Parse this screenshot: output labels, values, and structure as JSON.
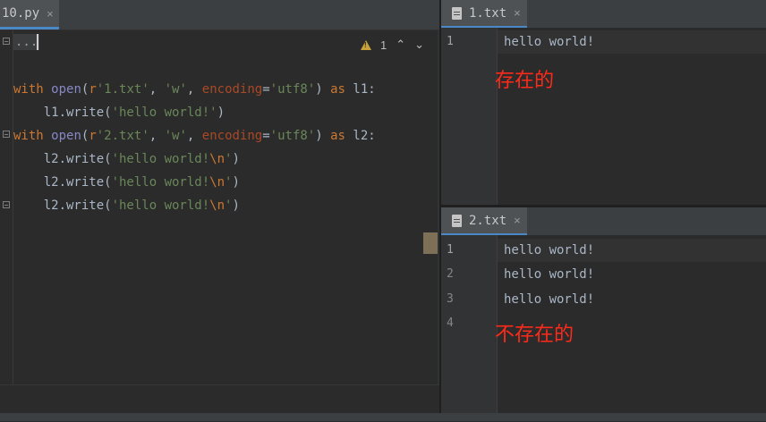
{
  "left_tab": {
    "label": "10.py",
    "close_glyph": "×"
  },
  "editor": {
    "collapsed_text": "...",
    "inspection": {
      "icon": "warning-icon",
      "count": "1",
      "up": "⌃",
      "down": "⌄"
    },
    "lines": [
      {
        "tokens": [
          [
            "kw",
            "with "
          ],
          [
            "bi",
            "open"
          ],
          [
            "",
            "("
          ],
          [
            "kw",
            "r"
          ],
          [
            "str",
            "'1.txt'"
          ],
          [
            "",
            ", "
          ],
          [
            "str",
            "'w'"
          ],
          [
            "",
            ", "
          ],
          [
            "param",
            "encoding"
          ],
          [
            "",
            "="
          ],
          [
            "str",
            "'utf8'"
          ],
          [
            "",
            ") "
          ],
          [
            "kw",
            "as "
          ],
          [
            "",
            "l1:"
          ]
        ]
      },
      {
        "tokens": [
          [
            "",
            "    l1.write("
          ],
          [
            "str",
            "'hello world!'"
          ],
          [
            "",
            ")"
          ]
        ]
      },
      {
        "tokens": [
          [
            "kw",
            "with "
          ],
          [
            "bi",
            "open"
          ],
          [
            "",
            "("
          ],
          [
            "kw",
            "r"
          ],
          [
            "str",
            "'2.txt'"
          ],
          [
            "",
            ", "
          ],
          [
            "str",
            "'w'"
          ],
          [
            "",
            ", "
          ],
          [
            "param",
            "encoding"
          ],
          [
            "",
            "="
          ],
          [
            "str",
            "'utf8'"
          ],
          [
            "",
            ") "
          ],
          [
            "kw",
            "as "
          ],
          [
            "",
            "l2:"
          ]
        ]
      },
      {
        "tokens": [
          [
            "",
            "    l2.write("
          ],
          [
            "str",
            "'hello world!"
          ],
          [
            "esc",
            "\\n"
          ],
          [
            "str",
            "'"
          ],
          [
            "",
            ")"
          ]
        ]
      },
      {
        "tokens": [
          [
            "",
            "    l2.write("
          ],
          [
            "str",
            "'hello world!"
          ],
          [
            "esc",
            "\\n"
          ],
          [
            "str",
            "'"
          ],
          [
            "",
            ")"
          ]
        ]
      },
      {
        "tokens": [
          [
            "",
            "    l2.write("
          ],
          [
            "str",
            "'hello world!"
          ],
          [
            "esc",
            "\\n"
          ],
          [
            "str",
            "'"
          ],
          [
            "",
            ")"
          ]
        ]
      }
    ]
  },
  "file1": {
    "tab_label": "1.txt",
    "close_glyph": "×",
    "line_numbers": [
      "1"
    ],
    "lines": [
      "hello world!"
    ],
    "annotation": "存在的"
  },
  "file2": {
    "tab_label": "2.txt",
    "close_glyph": "×",
    "line_numbers": [
      "1",
      "2",
      "3",
      "4"
    ],
    "lines": [
      "hello world!",
      "hello world!",
      "hello world!",
      ""
    ],
    "annotation": "不存在的"
  },
  "colors": {
    "background": "#2b2b2b",
    "tab_accent": "#4a88c7",
    "keyword": "#cc7832",
    "string": "#6a8759",
    "annotation": "#ff2a1a"
  }
}
